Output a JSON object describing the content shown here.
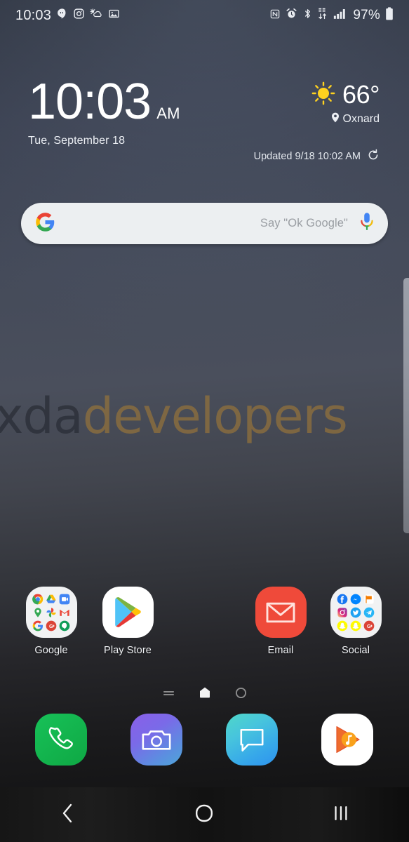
{
  "status_bar": {
    "clock": "10:03",
    "left_icons": [
      {
        "name": "hangouts-icon",
        "label": "Hangouts"
      },
      {
        "name": "instagram-icon",
        "label": "Instagram"
      },
      {
        "name": "weather-notification-icon",
        "label": "Weather"
      },
      {
        "name": "gallery-icon",
        "label": "Gallery"
      }
    ],
    "right_icons": [
      {
        "name": "nfc-icon",
        "label": "NFC"
      },
      {
        "name": "alarm-icon",
        "label": "Alarm"
      },
      {
        "name": "bluetooth-icon",
        "label": "Bluetooth"
      },
      {
        "name": "data-transfer-icon",
        "label": "Mobile data"
      },
      {
        "name": "signal-bars-icon",
        "label": "Signal"
      }
    ],
    "battery_percent": "97%"
  },
  "widget": {
    "time": "10:03",
    "ampm": "AM",
    "date": "Tue, September 18",
    "weather": {
      "icon": "sunny-icon",
      "temperature": "66°",
      "location": "Oxnard",
      "updated": "Updated 9/18 10:02 AM",
      "refresh_icon": "refresh-icon"
    }
  },
  "search": {
    "logo_icon": "google-g-icon",
    "placeholder": "Say \"Ok Google\"",
    "mic_icon": "microphone-icon"
  },
  "watermark": {
    "part1": "xda",
    "part2": "developers"
  },
  "apps": [
    {
      "name": "google-folder",
      "label": "Google",
      "type": "folder",
      "contents": [
        "Chrome",
        "Drive",
        "Duo",
        "Maps",
        "Photos",
        "Gmail",
        "Google",
        "Google+",
        "Hangouts"
      ]
    },
    {
      "name": "play-store",
      "label": "Play Store",
      "type": "app"
    },
    {
      "name": "email",
      "label": "Email",
      "type": "app"
    },
    {
      "name": "social-folder",
      "label": "Social",
      "type": "folder",
      "contents": [
        "Facebook",
        "Messenger",
        "Flag",
        "Instagram",
        "Twitter",
        "Telegram",
        "Snapchat",
        "Snapchat",
        "Google+"
      ]
    }
  ],
  "page_indicator": {
    "dots": [
      {
        "name": "page-dot-list",
        "active": false
      },
      {
        "name": "page-dot-home",
        "active": true
      },
      {
        "name": "page-dot-circle",
        "active": false
      }
    ]
  },
  "dock": [
    {
      "name": "phone-app",
      "label": "Phone",
      "color": "#14b24c"
    },
    {
      "name": "camera-app",
      "label": "Camera",
      "color": "#7a63e8"
    },
    {
      "name": "messages-app",
      "label": "Messages",
      "color": "#35b2e8"
    },
    {
      "name": "play-music-app",
      "label": "Play Music",
      "color": "#ffffff"
    }
  ],
  "nav_bar": {
    "back": {
      "name": "back-icon",
      "label": "Back"
    },
    "home": {
      "name": "home-icon",
      "label": "Home"
    },
    "recents": {
      "name": "recents-icon",
      "label": "Recents"
    }
  },
  "colors": {
    "accent_gold": "#96743a",
    "email_red": "#ef4a3a",
    "phone_green": "#14b24c",
    "search_bg": "#eceff1"
  }
}
